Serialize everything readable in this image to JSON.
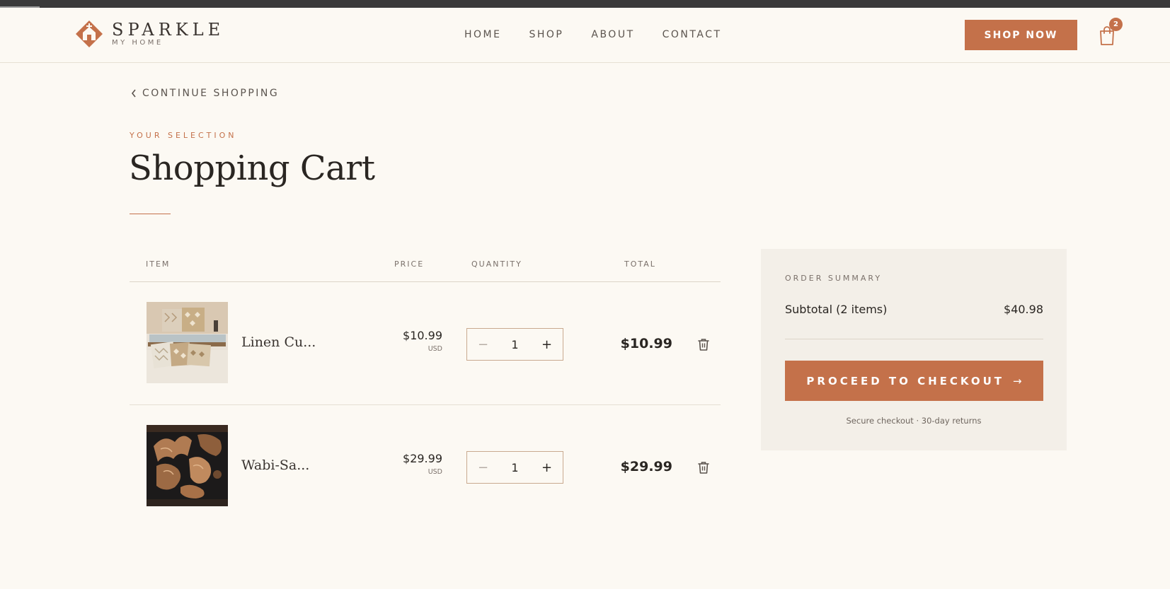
{
  "brand": {
    "name": "SPARKLE",
    "tagline": "MY HOME",
    "accent_color": "#c4714a"
  },
  "nav": {
    "items": [
      {
        "label": "HOME"
      },
      {
        "label": "SHOP"
      },
      {
        "label": "ABOUT"
      },
      {
        "label": "CONTACT"
      }
    ],
    "cta_label": "SHOP NOW",
    "cart_icon": "shopping-bag-icon",
    "cart_count": "2"
  },
  "page": {
    "back_link": "CONTINUE SHOPPING",
    "eyebrow": "YOUR SELECTION",
    "title": "Shopping Cart"
  },
  "cart": {
    "columns": {
      "item": "ITEM",
      "price": "PRICE",
      "quantity": "QUANTITY",
      "total": "TOTAL"
    },
    "rows": [
      {
        "name": "Linen Cu...",
        "price": "$10.99",
        "currency": "USD",
        "quantity": "1",
        "total": "$10.99",
        "image": "pillows-on-bench-photo"
      },
      {
        "name": "Wabi-Sa...",
        "price": "$29.99",
        "currency": "USD",
        "quantity": "1",
        "total": "$29.99",
        "image": "dragon-pottery-photo"
      }
    ],
    "minus_symbol": "−",
    "plus_symbol": "+"
  },
  "summary": {
    "eyebrow": "ORDER SUMMARY",
    "subtotal_label": "Subtotal (2 items)",
    "subtotal_value": "$40.98",
    "checkout_label": "PROCEED TO CHECKOUT",
    "checkout_arrow": "→",
    "secure_note": "Secure checkout · 30-day returns"
  }
}
